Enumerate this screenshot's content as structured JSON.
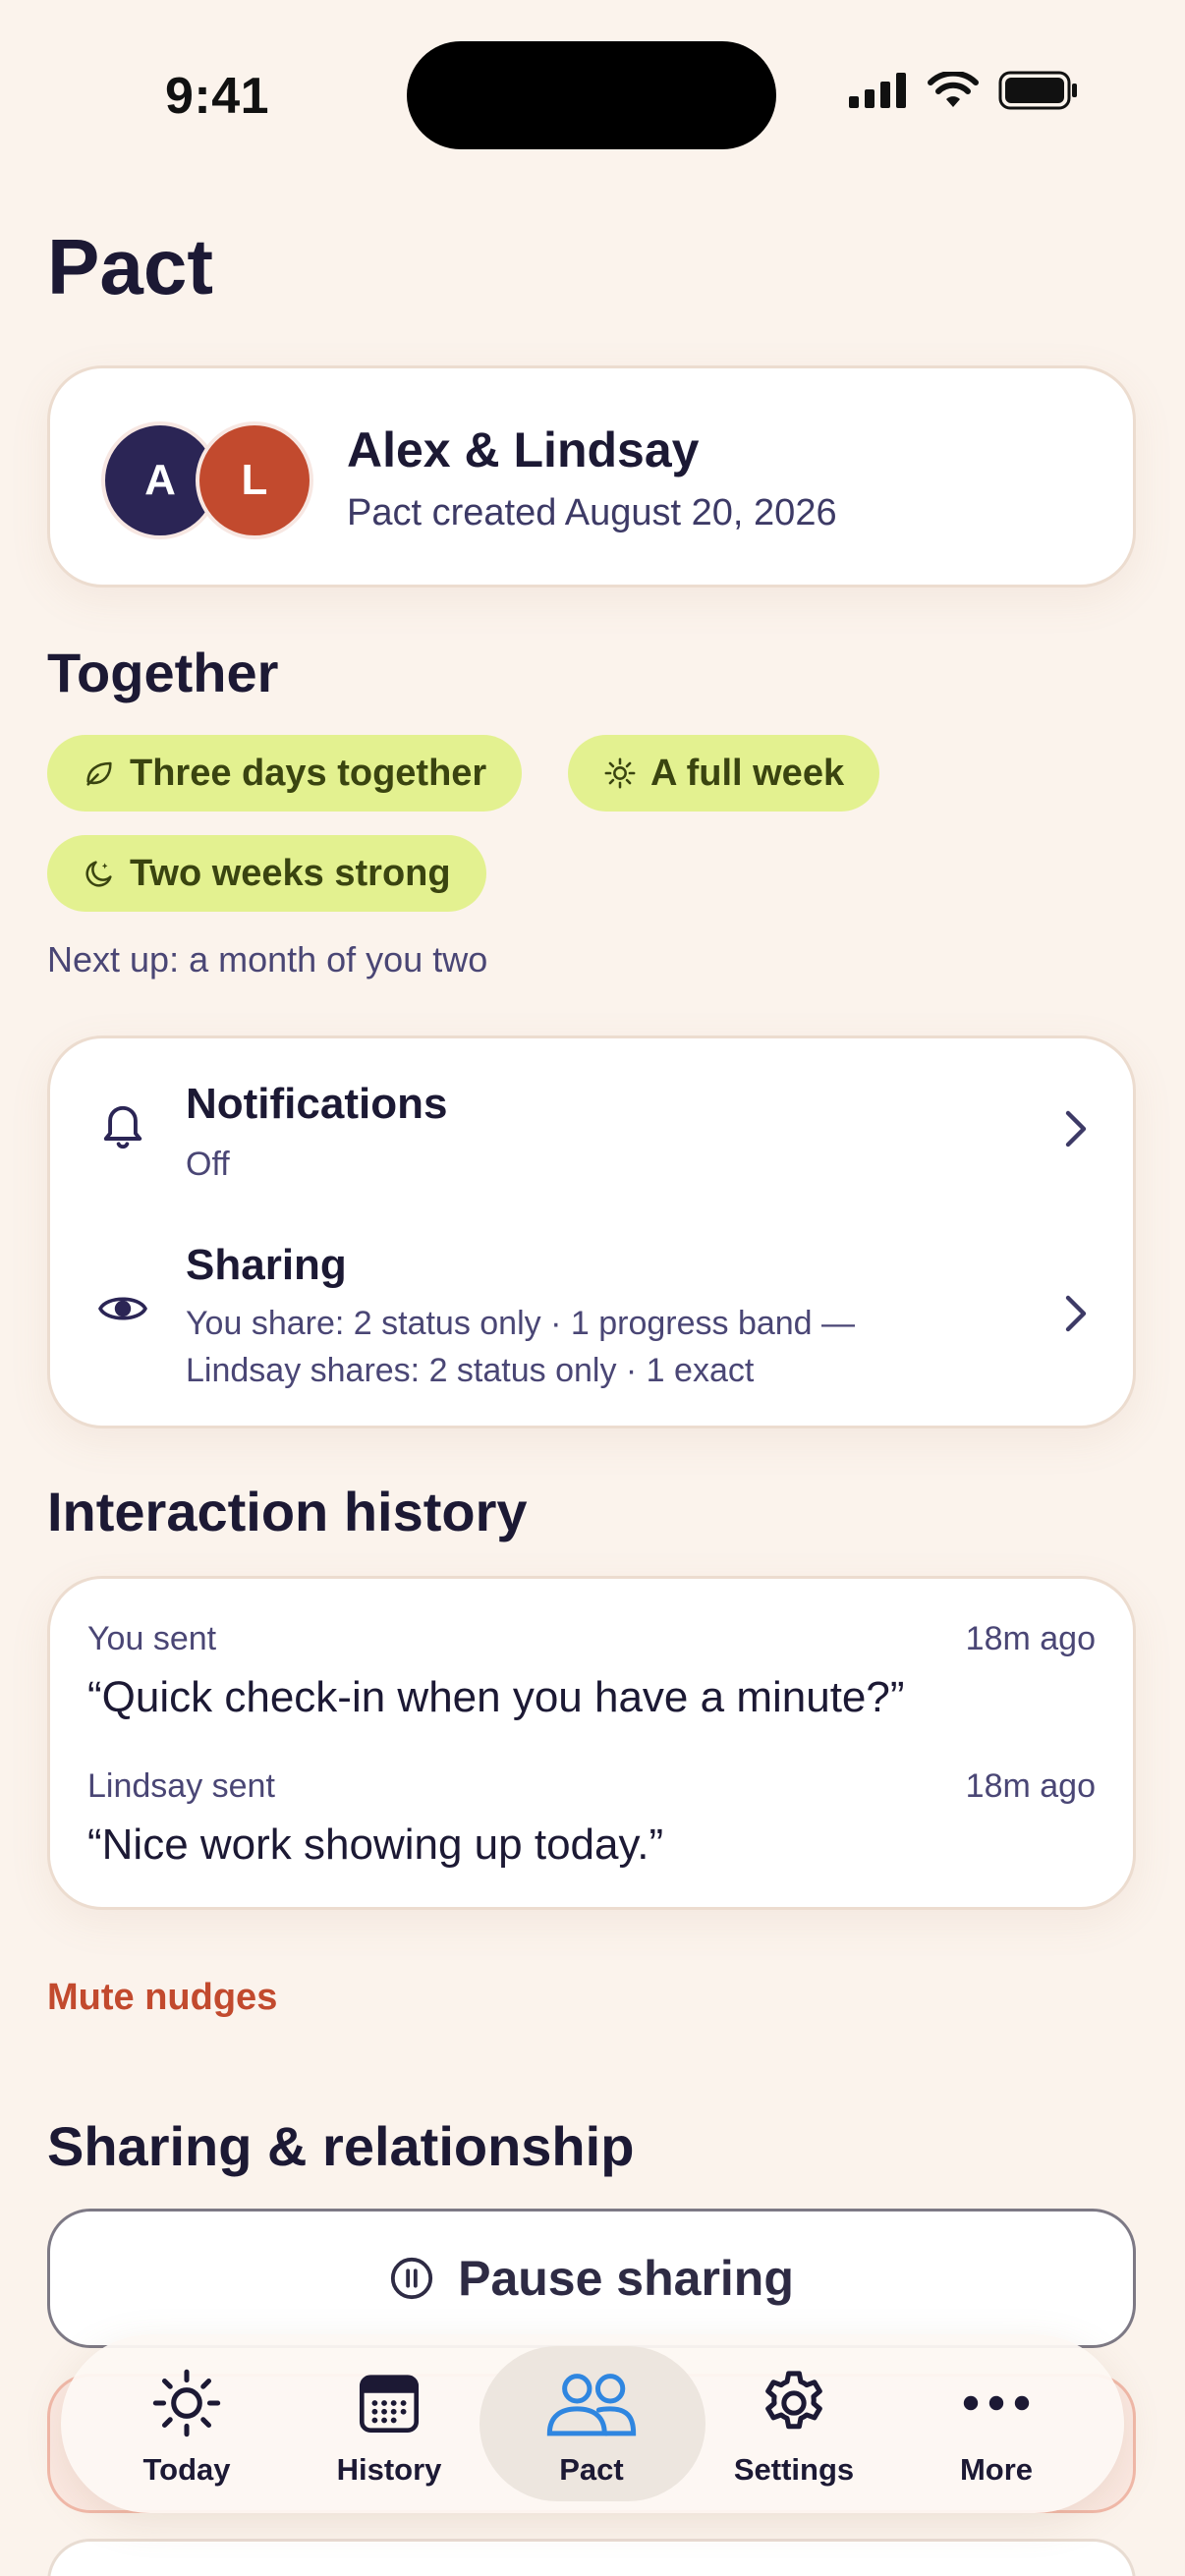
{
  "status_bar": {
    "time": "9:41"
  },
  "page_title": "Pact",
  "pact": {
    "avatar_a": "A",
    "avatar_l": "L",
    "names": "Alex & Lindsay",
    "created": "Pact created August 20, 2026"
  },
  "together": {
    "title": "Together",
    "chips": [
      {
        "label": "Three days together",
        "icon": "leaf-icon"
      },
      {
        "label": "A full week",
        "icon": "sun-icon"
      },
      {
        "label": "Two weeks strong",
        "icon": "moon-icon"
      }
    ],
    "next_up": "Next up: a month of you two"
  },
  "settings": {
    "notifications": {
      "title": "Notifications",
      "value": "Off"
    },
    "sharing": {
      "title": "Sharing",
      "line1": "You share: 2 status only · 1 progress band —",
      "line2": "Lindsay shares: 2 status only · 1 exact"
    }
  },
  "history": {
    "title": "Interaction history",
    "items": [
      {
        "label": "You sent",
        "time": "18m ago",
        "message": "“Quick check-in when you have a minute?”"
      },
      {
        "label": "Lindsay sent",
        "time": "18m ago",
        "message": "“Nice work showing up today.”"
      }
    ]
  },
  "mute_label": "Mute nudges",
  "relationship": {
    "title": "Sharing & relationship",
    "pause_label": "Pause sharing"
  },
  "tabs": [
    {
      "label": "Today",
      "icon": "sun-icon"
    },
    {
      "label": "History",
      "icon": "calendar-icon"
    },
    {
      "label": "Pact",
      "icon": "people-icon",
      "active": true
    },
    {
      "label": "Settings",
      "icon": "gear-icon"
    },
    {
      "label": "More",
      "icon": "more-icon"
    }
  ],
  "colors": {
    "background": "#fbf3ec",
    "accent": "#2f86e0",
    "chip": "#e3f190",
    "danger": "#c24a2e"
  }
}
